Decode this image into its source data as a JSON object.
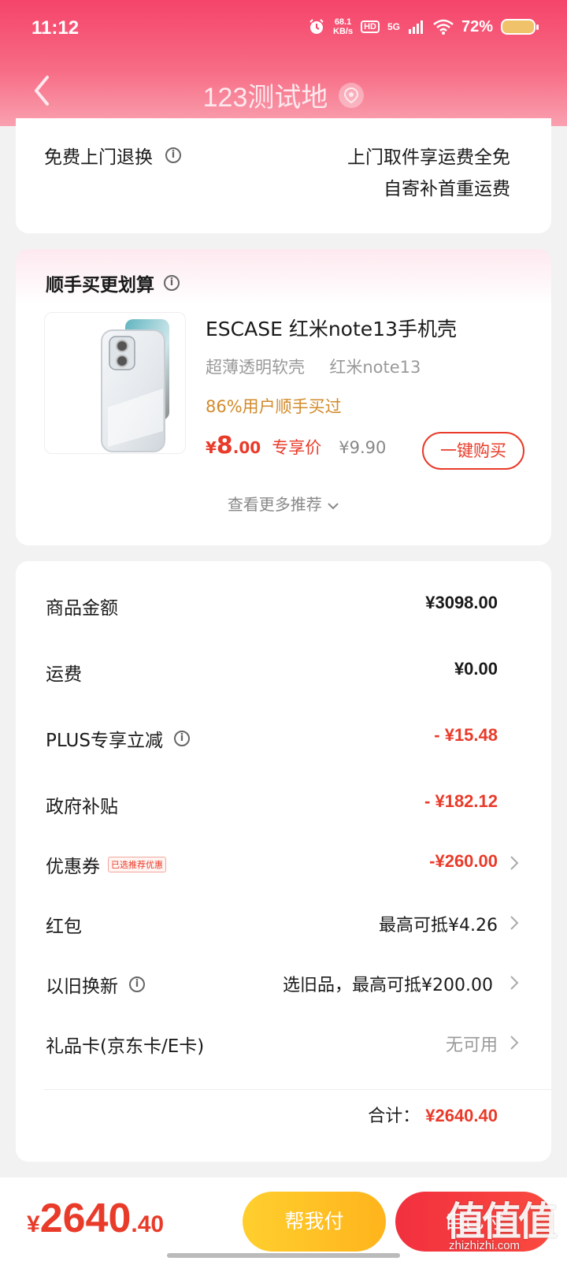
{
  "status_bar": {
    "time": "11:12",
    "net_speed_value": "68.1",
    "net_speed_unit": "KB/s",
    "hd_badge": "HD",
    "network": "5G",
    "battery": "72%"
  },
  "nav": {
    "title": "123测试地"
  },
  "return_service": {
    "label": "免费上门退换",
    "line1": "上门取件享运费全免",
    "line2": "自寄补首重运费"
  },
  "recommendation": {
    "title": "顺手买更划算",
    "product": {
      "name": "ESCASE 红米note13手机壳",
      "spec1": "超薄透明软壳",
      "spec2": "红米note13",
      "bought": "86%用户顺手买过",
      "price_symbol": "¥",
      "price_int": "8",
      "price_dec": ".00",
      "price_tag": "专享价",
      "orig_price": "¥9.90",
      "buy_label": "一键购买"
    },
    "more_label": "查看更多推荐"
  },
  "summary": {
    "rows": [
      {
        "label": "商品金额",
        "value": "¥3098.00"
      },
      {
        "label": "运费",
        "value": "¥0.00"
      },
      {
        "label": "PLUS专享立减",
        "value": "- ¥15.48"
      },
      {
        "label": "政府补贴",
        "value": "- ¥182.12"
      },
      {
        "label": "优惠券",
        "badge": "已选推荐优惠",
        "value": "-¥260.00"
      },
      {
        "label": "红包",
        "value": "最高可抵¥4.26"
      },
      {
        "label": "以旧换新",
        "value": "选旧品，最高可抵¥200.00"
      },
      {
        "label": "礼品卡(京东卡/E卡)",
        "value": "无可用"
      }
    ],
    "total_label": "合计：",
    "total_value": "¥2640.40"
  },
  "bottom_bar": {
    "total_symbol": "¥",
    "total_int": "2640",
    "total_dec": ".40",
    "help_pay_label": "帮我付",
    "self_pay_label": "自己付"
  },
  "watermark": {
    "logo": "值值值",
    "url": "zhizhizhi.com"
  },
  "colors": {
    "brand_red": "#e93b2a",
    "header_pink": "#f5446a",
    "help_pay_yellow": "#ffb41c",
    "bought_orange": "#d28a2a"
  },
  "icons": [
    "back-icon",
    "location-icon",
    "info-icon",
    "chevron-right-icon",
    "chevron-down-icon",
    "alarm-icon",
    "wifi-icon",
    "signal-icon",
    "battery-icon"
  ]
}
